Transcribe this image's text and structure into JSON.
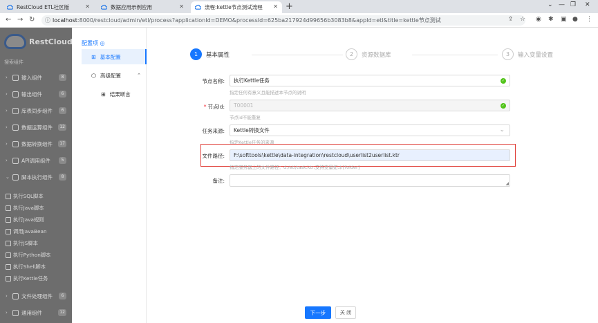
{
  "browser": {
    "tabs": [
      {
        "title": "RestCloud ETL社区版",
        "active": false
      },
      {
        "title": "数据应用示例应用",
        "active": false
      },
      {
        "title": "流程:kettle节点测试流程",
        "active": true
      }
    ],
    "new_tab": "+",
    "url_host": "localhost",
    "url_rest": ":8000/restcloud/admin/etl/process?applicationId=DEMO&processId=625ba217924d99656b3083b8&appId=etl&title=kettle节点测试"
  },
  "leftnav": {
    "brand": "RestCloud",
    "search_label": "搜索组件",
    "groups": [
      {
        "label": "输入组件",
        "count": "8"
      },
      {
        "label": "输出组件",
        "count": "6"
      },
      {
        "label": "库表同步组件",
        "count": "6"
      },
      {
        "label": "数据运算组件",
        "count": "12"
      },
      {
        "label": "数据转换组件",
        "count": "17"
      },
      {
        "label": "API调用组件",
        "count": "5"
      },
      {
        "label": "脚本执行组件",
        "count": "8"
      }
    ],
    "script_items": [
      "执行SQL脚本",
      "执行Java脚本",
      "执行Java规则",
      "调用JavaBean",
      "执行JS脚本",
      "执行Python脚本",
      "执行Shell脚本",
      "执行Kettle任务"
    ],
    "bottom_groups": [
      {
        "label": "文件处理组件",
        "count": "6"
      },
      {
        "label": "通用组件",
        "count": "12"
      }
    ]
  },
  "config": {
    "title": "配置项",
    "items": [
      "基本配置",
      "高级配置",
      "结果断言"
    ]
  },
  "steps": [
    {
      "num": "1",
      "label": "基本属性"
    },
    {
      "num": "2",
      "label": "资源数据库"
    },
    {
      "num": "3",
      "label": "输入变量设置"
    }
  ],
  "form": {
    "node_name": {
      "label": "节点名称:",
      "value": "执行Kettle任务",
      "hint": "指定任何有意义且能描述本节点的说明"
    },
    "node_id": {
      "label": "节点Id:",
      "value": "T00001",
      "hint": "节点id不能重复"
    },
    "task_source": {
      "label": "任务来源:",
      "value": "Kettle转换文件",
      "hint": "指定Kettle任务的来源"
    },
    "file_path": {
      "label": "文件路径:",
      "value": "F:\\softtools\\kettle\\data-integration\\restcloud\\userlist2userlist.ktr",
      "hint": "指定服务器上的文件路径：d:/etl/task.ktr,支持变量如:${folder}"
    },
    "remark": {
      "label": "备注:",
      "value": ""
    }
  },
  "buttons": {
    "next": "下一步",
    "close": "关 闭"
  },
  "colors": {
    "accent": "#1677ff",
    "highlight": "#e0403a",
    "ok": "#52c41a"
  }
}
